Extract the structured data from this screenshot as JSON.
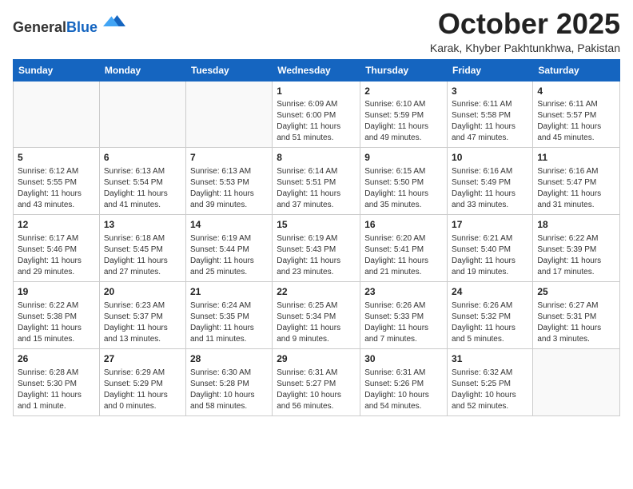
{
  "header": {
    "logo_general": "General",
    "logo_blue": "Blue",
    "month": "October 2025",
    "location": "Karak, Khyber Pakhtunkhwa, Pakistan"
  },
  "weekdays": [
    "Sunday",
    "Monday",
    "Tuesday",
    "Wednesday",
    "Thursday",
    "Friday",
    "Saturday"
  ],
  "weeks": [
    [
      {
        "day": "",
        "info": ""
      },
      {
        "day": "",
        "info": ""
      },
      {
        "day": "",
        "info": ""
      },
      {
        "day": "1",
        "info": "Sunrise: 6:09 AM\nSunset: 6:00 PM\nDaylight: 11 hours and 51 minutes."
      },
      {
        "day": "2",
        "info": "Sunrise: 6:10 AM\nSunset: 5:59 PM\nDaylight: 11 hours and 49 minutes."
      },
      {
        "day": "3",
        "info": "Sunrise: 6:11 AM\nSunset: 5:58 PM\nDaylight: 11 hours and 47 minutes."
      },
      {
        "day": "4",
        "info": "Sunrise: 6:11 AM\nSunset: 5:57 PM\nDaylight: 11 hours and 45 minutes."
      }
    ],
    [
      {
        "day": "5",
        "info": "Sunrise: 6:12 AM\nSunset: 5:55 PM\nDaylight: 11 hours and 43 minutes."
      },
      {
        "day": "6",
        "info": "Sunrise: 6:13 AM\nSunset: 5:54 PM\nDaylight: 11 hours and 41 minutes."
      },
      {
        "day": "7",
        "info": "Sunrise: 6:13 AM\nSunset: 5:53 PM\nDaylight: 11 hours and 39 minutes."
      },
      {
        "day": "8",
        "info": "Sunrise: 6:14 AM\nSunset: 5:51 PM\nDaylight: 11 hours and 37 minutes."
      },
      {
        "day": "9",
        "info": "Sunrise: 6:15 AM\nSunset: 5:50 PM\nDaylight: 11 hours and 35 minutes."
      },
      {
        "day": "10",
        "info": "Sunrise: 6:16 AM\nSunset: 5:49 PM\nDaylight: 11 hours and 33 minutes."
      },
      {
        "day": "11",
        "info": "Sunrise: 6:16 AM\nSunset: 5:47 PM\nDaylight: 11 hours and 31 minutes."
      }
    ],
    [
      {
        "day": "12",
        "info": "Sunrise: 6:17 AM\nSunset: 5:46 PM\nDaylight: 11 hours and 29 minutes."
      },
      {
        "day": "13",
        "info": "Sunrise: 6:18 AM\nSunset: 5:45 PM\nDaylight: 11 hours and 27 minutes."
      },
      {
        "day": "14",
        "info": "Sunrise: 6:19 AM\nSunset: 5:44 PM\nDaylight: 11 hours and 25 minutes."
      },
      {
        "day": "15",
        "info": "Sunrise: 6:19 AM\nSunset: 5:43 PM\nDaylight: 11 hours and 23 minutes."
      },
      {
        "day": "16",
        "info": "Sunrise: 6:20 AM\nSunset: 5:41 PM\nDaylight: 11 hours and 21 minutes."
      },
      {
        "day": "17",
        "info": "Sunrise: 6:21 AM\nSunset: 5:40 PM\nDaylight: 11 hours and 19 minutes."
      },
      {
        "day": "18",
        "info": "Sunrise: 6:22 AM\nSunset: 5:39 PM\nDaylight: 11 hours and 17 minutes."
      }
    ],
    [
      {
        "day": "19",
        "info": "Sunrise: 6:22 AM\nSunset: 5:38 PM\nDaylight: 11 hours and 15 minutes."
      },
      {
        "day": "20",
        "info": "Sunrise: 6:23 AM\nSunset: 5:37 PM\nDaylight: 11 hours and 13 minutes."
      },
      {
        "day": "21",
        "info": "Sunrise: 6:24 AM\nSunset: 5:35 PM\nDaylight: 11 hours and 11 minutes."
      },
      {
        "day": "22",
        "info": "Sunrise: 6:25 AM\nSunset: 5:34 PM\nDaylight: 11 hours and 9 minutes."
      },
      {
        "day": "23",
        "info": "Sunrise: 6:26 AM\nSunset: 5:33 PM\nDaylight: 11 hours and 7 minutes."
      },
      {
        "day": "24",
        "info": "Sunrise: 6:26 AM\nSunset: 5:32 PM\nDaylight: 11 hours and 5 minutes."
      },
      {
        "day": "25",
        "info": "Sunrise: 6:27 AM\nSunset: 5:31 PM\nDaylight: 11 hours and 3 minutes."
      }
    ],
    [
      {
        "day": "26",
        "info": "Sunrise: 6:28 AM\nSunset: 5:30 PM\nDaylight: 11 hours and 1 minute."
      },
      {
        "day": "27",
        "info": "Sunrise: 6:29 AM\nSunset: 5:29 PM\nDaylight: 11 hours and 0 minutes."
      },
      {
        "day": "28",
        "info": "Sunrise: 6:30 AM\nSunset: 5:28 PM\nDaylight: 10 hours and 58 minutes."
      },
      {
        "day": "29",
        "info": "Sunrise: 6:31 AM\nSunset: 5:27 PM\nDaylight: 10 hours and 56 minutes."
      },
      {
        "day": "30",
        "info": "Sunrise: 6:31 AM\nSunset: 5:26 PM\nDaylight: 10 hours and 54 minutes."
      },
      {
        "day": "31",
        "info": "Sunrise: 6:32 AM\nSunset: 5:25 PM\nDaylight: 10 hours and 52 minutes."
      },
      {
        "day": "",
        "info": ""
      }
    ]
  ]
}
